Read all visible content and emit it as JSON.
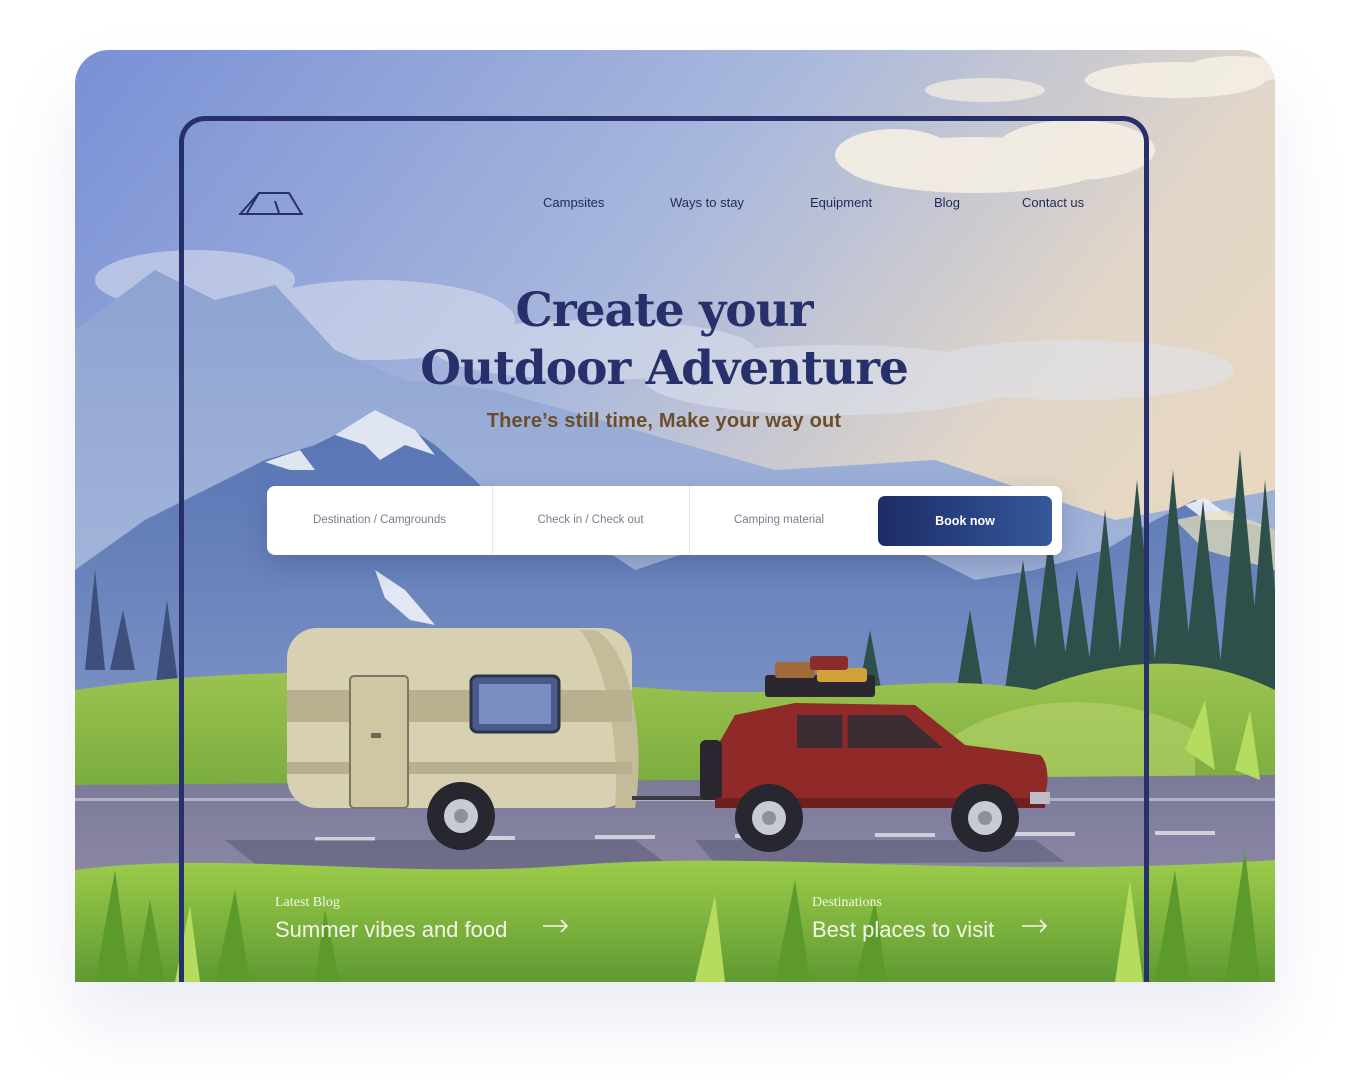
{
  "nav": {
    "items": [
      {
        "label": "Campsites"
      },
      {
        "label": "Ways to stay"
      },
      {
        "label": "Equipment"
      },
      {
        "label": "Blog"
      },
      {
        "label": "Contact us"
      }
    ]
  },
  "hero": {
    "title_line1": "Create your",
    "title_line2": "Outdoor Adventure",
    "subtitle": "There’s still time, Make your way out"
  },
  "search": {
    "destination": "Destination / Camgrounds",
    "dates": "Check in / Check out",
    "material": "Camping material",
    "cta": "Book now"
  },
  "promos": [
    {
      "label": "Latest Blog",
      "title": "Summer vibes and food"
    },
    {
      "label": "Destinations",
      "title": "Best places to visit"
    }
  ],
  "icons": {
    "logo": "tent-logo-icon",
    "arrow": "arrow-right-icon"
  },
  "colors": {
    "navy": "#27306b",
    "cta_gradient_start": "#1d2c67",
    "cta_gradient_end": "#34589a",
    "subtitle_brown": "#6b4e2a",
    "car_red": "#8f2a28",
    "caravan_beige": "#d8d0b2"
  }
}
